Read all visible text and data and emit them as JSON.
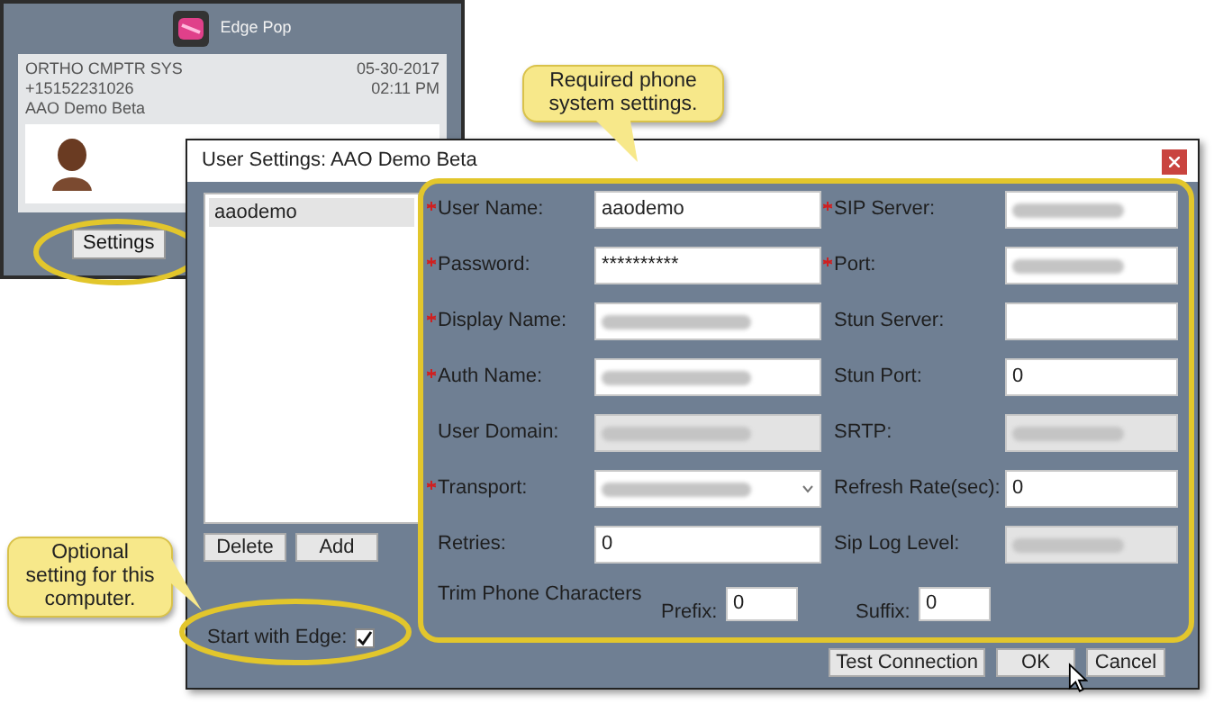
{
  "edge_pop": {
    "title": "Edge Pop",
    "lines": [
      {
        "left": "ORTHO CMPTR SYS",
        "right": "05-30-2017"
      },
      {
        "left": "+15152231026",
        "right": "02:11 PM"
      },
      {
        "left": "AAO Demo Beta"
      }
    ],
    "settings_button": "Settings"
  },
  "dialog": {
    "title": "User Settings: AAO Demo Beta",
    "accounts": [
      {
        "label": "aaodemo",
        "selected": true
      }
    ],
    "list_buttons": [
      "Delete",
      "Add"
    ],
    "start_with_edge": {
      "label": "Start with Edge:",
      "checked": true
    },
    "fields": [
      {
        "label": "User Name:",
        "required": true,
        "kind": "text",
        "value": "aaodemo",
        "blurred": false,
        "disabled": false
      },
      {
        "label": "SIP Server:",
        "required": true,
        "kind": "text",
        "blurred": true,
        "disabled": false
      },
      {
        "label": "Password:",
        "required": true,
        "kind": "text",
        "value": "**********",
        "blurred": false,
        "disabled": false
      },
      {
        "label": "Port:",
        "required": true,
        "kind": "text",
        "blurred": true,
        "disabled": false
      },
      {
        "label": "Display Name:",
        "required": true,
        "kind": "text",
        "blurred": true,
        "disabled": false
      },
      {
        "label": "Stun Server:",
        "required": false,
        "kind": "text",
        "blurred": false,
        "disabled": false
      },
      {
        "label": "Auth Name:",
        "required": true,
        "kind": "text",
        "blurred": true,
        "disabled": false
      },
      {
        "label": "Stun Port:",
        "required": false,
        "kind": "text",
        "value": "0",
        "blurred": false,
        "disabled": false
      },
      {
        "label": "User Domain:",
        "required": false,
        "kind": "text",
        "blurred": true,
        "disabled": true
      },
      {
        "label": "SRTP:",
        "required": false,
        "kind": "select",
        "blurred": true,
        "disabled": true
      },
      {
        "label": "Transport:",
        "required": true,
        "kind": "select",
        "blurred": true,
        "disabled": false
      },
      {
        "label": "Refresh Rate(sec):",
        "required": false,
        "kind": "text",
        "value": "0",
        "blurred": false,
        "disabled": false
      },
      {
        "label": "Retries:",
        "required": false,
        "kind": "text",
        "value": "0",
        "blurred": false,
        "disabled": false
      },
      {
        "label": "Sip Log Level:",
        "required": false,
        "kind": "select",
        "blurred": true,
        "disabled": true
      }
    ],
    "trim": {
      "label": "Trim Phone Characters",
      "prefix": {
        "label": "Prefix:",
        "value": "0"
      },
      "suffix": {
        "label": "Suffix:",
        "value": "0"
      }
    },
    "actions": [
      "Test Connection",
      "OK",
      "Cancel"
    ]
  },
  "callouts": [
    "Required phone system settings.",
    "Optional setting for this computer."
  ]
}
